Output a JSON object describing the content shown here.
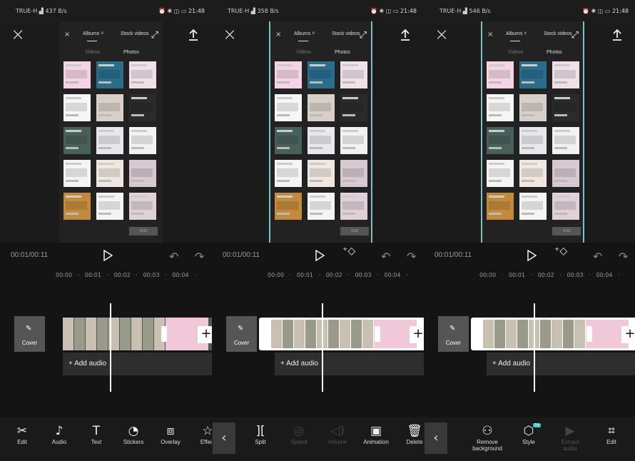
{
  "status": {
    "carrier": "TRUE-H",
    "net": "4G",
    "time": "21:48",
    "speeds": [
      "437 B/s",
      "358 B/s",
      "546 B/s"
    ]
  },
  "picker": {
    "albums_label": "Albums",
    "stock_label": "Stock videos",
    "videos_tab": "Videos",
    "photos_tab": "Photos",
    "add_label": "Add"
  },
  "playback": {
    "timecode": "00:01/00:11"
  },
  "ruler": {
    "text": "00:00   ·   00:01   ·   00:02   ·   00:03   ·   00:04   ·"
  },
  "timeline": {
    "cover_label": "Cover",
    "add_audio_label": "Add audio"
  },
  "toolbar_main": [
    {
      "label": "Edit",
      "icon": "scissors-icon",
      "glyph": "✂"
    },
    {
      "label": "Audio",
      "icon": "music-note-icon",
      "glyph": "♪"
    },
    {
      "label": "Text",
      "icon": "text-icon",
      "glyph": "T"
    },
    {
      "label": "Stickers",
      "icon": "sticker-icon",
      "glyph": "◔"
    },
    {
      "label": "Overlay",
      "icon": "overlay-icon",
      "glyph": "⧈"
    },
    {
      "label": "Effect",
      "icon": "effect-star-icon",
      "glyph": "☆"
    }
  ],
  "toolbar_edit": [
    {
      "label": "Split",
      "icon": "split-icon",
      "glyph": "][",
      "dim": false
    },
    {
      "label": "Speed",
      "icon": "speed-icon",
      "glyph": "◎",
      "dim": true
    },
    {
      "label": "Volume",
      "icon": "volume-icon",
      "glyph": "◁)",
      "dim": true
    },
    {
      "label": "Animation",
      "icon": "animation-icon",
      "glyph": "▣",
      "dim": false
    },
    {
      "label": "Delete",
      "icon": "trash-icon",
      "glyph": "🗑",
      "dim": false
    }
  ],
  "toolbar_third": [
    {
      "label": "Remove background",
      "icon": "remove-background-icon",
      "glyph": "⚇",
      "dim": false
    },
    {
      "label": "Style",
      "icon": "style-cube-icon",
      "glyph": "⬡",
      "dim": false,
      "badge": "Try"
    },
    {
      "label": "Extract audio",
      "icon": "extract-audio-icon",
      "glyph": "▶",
      "dim": true
    },
    {
      "label": "Edit",
      "icon": "crop-icon",
      "glyph": "⌗",
      "dim": false
    }
  ],
  "back_glyph": "‹",
  "colors": {
    "bg": "#141414",
    "accent": "#7fc0c0",
    "toolbar": "#1a1a1a"
  }
}
